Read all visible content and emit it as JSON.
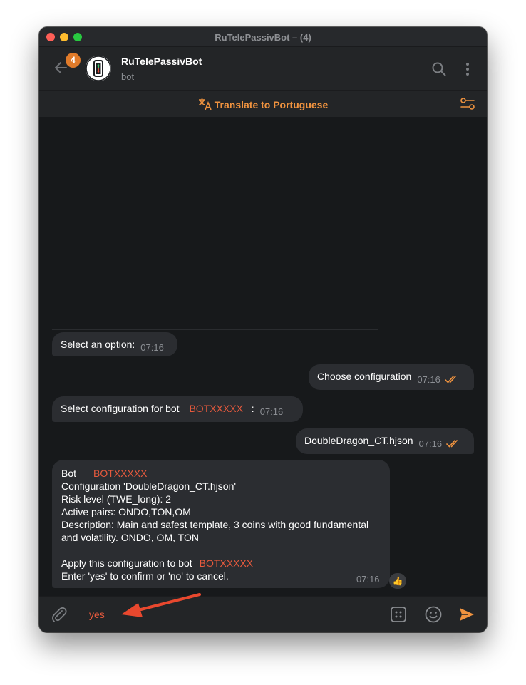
{
  "window": {
    "title": "RuTelePassivBot – (4)"
  },
  "header": {
    "unread_count": "4",
    "chat_name": "RuTelePassivBot",
    "chat_status": "bot"
  },
  "translate": {
    "label": "Translate to Portuguese"
  },
  "messages": {
    "m1": {
      "text": "Select an option:",
      "time": "07:16"
    },
    "m2": {
      "text": "Choose configuration",
      "time": "07:16"
    },
    "m3": {
      "text": "Select configuration for bot",
      "bot_id": "BOTXXXXX",
      "suffix": ":",
      "time": "07:16"
    },
    "m4": {
      "text": "DoubleDragon_CT.hjson",
      "time": "07:16"
    },
    "m5": {
      "bot_label": "Bot",
      "bot_id": "BOTXXXXX",
      "configuration": "Configuration 'DoubleDragon_CT.hjson'",
      "risk": "Risk level (TWE_long): 2",
      "pairs": "Active pairs: ONDO,TON,OM",
      "desc1": "Description: Main and safest template, 3 coins with good fundamental",
      "desc2": "and volatility. ONDO, OM, TON",
      "apply_label": "Apply this configuration to bot",
      "apply_bot_id": "BOTXXXXX",
      "confirm": "Enter 'yes' to confirm or 'no' to cancel.",
      "time": "07:16",
      "reaction": "👍"
    }
  },
  "composer": {
    "value": "yes"
  },
  "colors": {
    "accent": "#f0933f",
    "bubble": "#2b2d31",
    "background": "#17191b",
    "highlight": "#e85a3d"
  }
}
